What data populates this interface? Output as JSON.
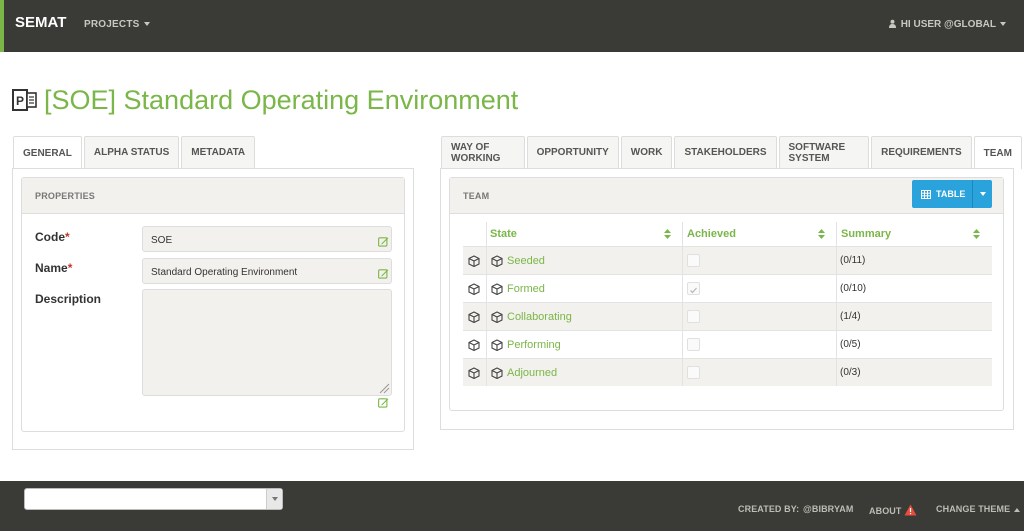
{
  "navbar": {
    "brand": "SEMAT",
    "projects_label": "PROJECTS",
    "user_label": "HI USER @GLOBAL"
  },
  "page": {
    "title": "[SOE] Standard Operating Environment"
  },
  "left_tabs": [
    {
      "label": "GENERAL",
      "active": true
    },
    {
      "label": "ALPHA STATUS",
      "active": false
    },
    {
      "label": "METADATA",
      "active": false
    }
  ],
  "properties": {
    "header": "PROPERTIES",
    "code_label": "Code",
    "code_value": "SOE",
    "name_label": "Name",
    "name_value": "Standard Operating Environment",
    "description_label": "Description",
    "description_value": "",
    "required_marker": "*"
  },
  "right_tabs": [
    {
      "label": "WAY OF WORKING",
      "active": false
    },
    {
      "label": "OPPORTUNITY",
      "active": false
    },
    {
      "label": "WORK",
      "active": false
    },
    {
      "label": "STAKEHOLDERS",
      "active": false
    },
    {
      "label": "SOFTWARE SYSTEM",
      "active": false
    },
    {
      "label": "REQUIREMENTS",
      "active": false
    },
    {
      "label": "TEAM",
      "active": true
    }
  ],
  "team": {
    "header": "TEAM",
    "view_button": "TABLE",
    "columns": [
      "State",
      "Achieved",
      "Summary"
    ],
    "rows": [
      {
        "state": "Seeded",
        "achieved": false,
        "summary": "(0/11)"
      },
      {
        "state": "Formed",
        "achieved": true,
        "summary": "(0/10)"
      },
      {
        "state": "Collaborating",
        "achieved": false,
        "summary": "(1/4)"
      },
      {
        "state": "Performing",
        "achieved": false,
        "summary": "(0/5)"
      },
      {
        "state": "Adjourned",
        "achieved": false,
        "summary": "(0/3)"
      }
    ]
  },
  "footer": {
    "created_by_label": "CREATED BY:",
    "author": "@BIBRYAM",
    "about_label": "ABOUT",
    "change_theme_label": "CHANGE THEME",
    "select_value": ""
  },
  "colors": {
    "accent_green": "#7ab648",
    "navbar_bg": "#3a3a36",
    "button_blue": "#2aa3dc",
    "warning_red": "#e74c3c"
  }
}
